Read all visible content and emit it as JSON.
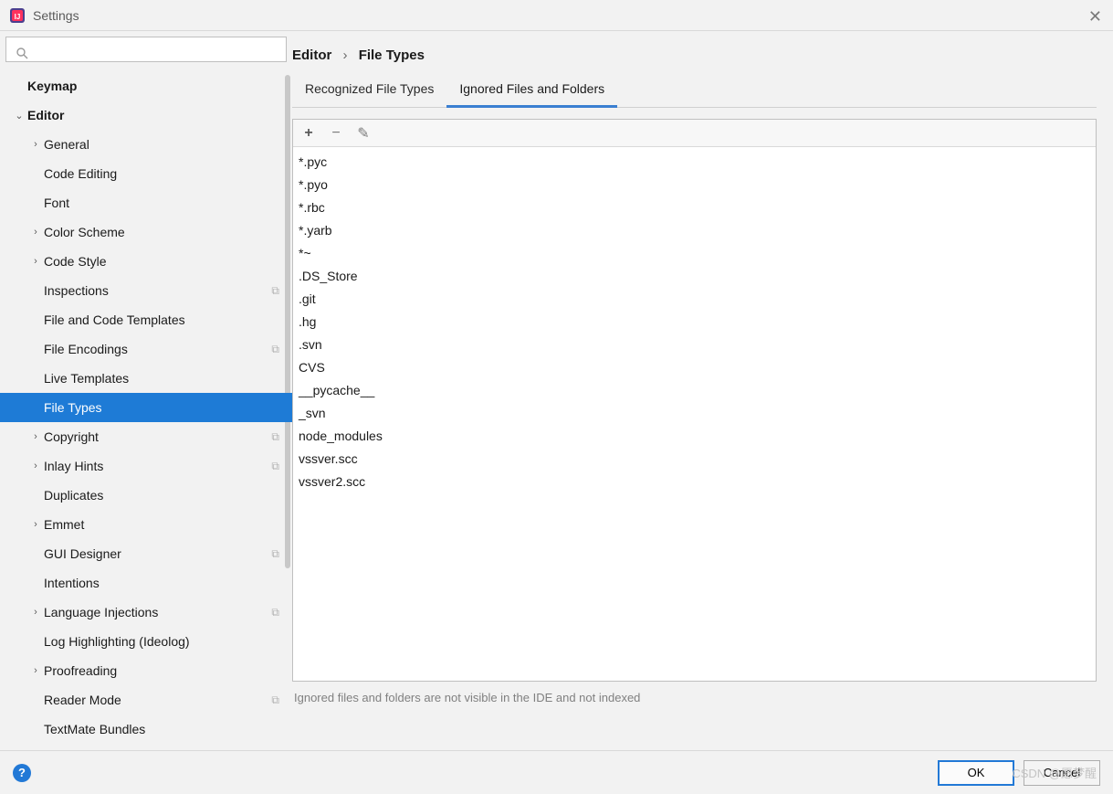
{
  "window": {
    "title": "Settings"
  },
  "breadcrumb": {
    "parent": "Editor",
    "current": "File Types"
  },
  "search": {
    "placeholder": ""
  },
  "tree": [
    {
      "label": "Keymap",
      "depth": 0,
      "expandable": false,
      "bold": true,
      "selected": false,
      "copy": false
    },
    {
      "label": "Editor",
      "depth": 0,
      "expandable": true,
      "expanded": true,
      "bold": true,
      "selected": false,
      "copy": false
    },
    {
      "label": "General",
      "depth": 1,
      "expandable": true,
      "expanded": false,
      "bold": false,
      "selected": false,
      "copy": false
    },
    {
      "label": "Code Editing",
      "depth": 1,
      "expandable": false,
      "bold": false,
      "selected": false,
      "copy": false
    },
    {
      "label": "Font",
      "depth": 1,
      "expandable": false,
      "bold": false,
      "selected": false,
      "copy": false
    },
    {
      "label": "Color Scheme",
      "depth": 1,
      "expandable": true,
      "expanded": false,
      "bold": false,
      "selected": false,
      "copy": false
    },
    {
      "label": "Code Style",
      "depth": 1,
      "expandable": true,
      "expanded": false,
      "bold": false,
      "selected": false,
      "copy": false
    },
    {
      "label": "Inspections",
      "depth": 1,
      "expandable": false,
      "bold": false,
      "selected": false,
      "copy": true
    },
    {
      "label": "File and Code Templates",
      "depth": 1,
      "expandable": false,
      "bold": false,
      "selected": false,
      "copy": false
    },
    {
      "label": "File Encodings",
      "depth": 1,
      "expandable": false,
      "bold": false,
      "selected": false,
      "copy": true
    },
    {
      "label": "Live Templates",
      "depth": 1,
      "expandable": false,
      "bold": false,
      "selected": false,
      "copy": false
    },
    {
      "label": "File Types",
      "depth": 1,
      "expandable": false,
      "bold": false,
      "selected": true,
      "copy": false
    },
    {
      "label": "Copyright",
      "depth": 1,
      "expandable": true,
      "expanded": false,
      "bold": false,
      "selected": false,
      "copy": true
    },
    {
      "label": "Inlay Hints",
      "depth": 1,
      "expandable": true,
      "expanded": false,
      "bold": false,
      "selected": false,
      "copy": true
    },
    {
      "label": "Duplicates",
      "depth": 1,
      "expandable": false,
      "bold": false,
      "selected": false,
      "copy": false
    },
    {
      "label": "Emmet",
      "depth": 1,
      "expandable": true,
      "expanded": false,
      "bold": false,
      "selected": false,
      "copy": false
    },
    {
      "label": "GUI Designer",
      "depth": 1,
      "expandable": false,
      "bold": false,
      "selected": false,
      "copy": true
    },
    {
      "label": "Intentions",
      "depth": 1,
      "expandable": false,
      "bold": false,
      "selected": false,
      "copy": false
    },
    {
      "label": "Language Injections",
      "depth": 1,
      "expandable": true,
      "expanded": false,
      "bold": false,
      "selected": false,
      "copy": true
    },
    {
      "label": "Log Highlighting (Ideolog)",
      "depth": 1,
      "expandable": false,
      "bold": false,
      "selected": false,
      "copy": false
    },
    {
      "label": "Proofreading",
      "depth": 1,
      "expandable": true,
      "expanded": false,
      "bold": false,
      "selected": false,
      "copy": false
    },
    {
      "label": "Reader Mode",
      "depth": 1,
      "expandable": false,
      "bold": false,
      "selected": false,
      "copy": true
    },
    {
      "label": "TextMate Bundles",
      "depth": 1,
      "expandable": false,
      "bold": false,
      "selected": false,
      "copy": false
    }
  ],
  "tabs": [
    {
      "label": "Recognized File Types",
      "active": false
    },
    {
      "label": "Ignored Files and Folders",
      "active": true
    }
  ],
  "toolbar": {
    "add": "+",
    "remove": "−",
    "edit": "✎"
  },
  "patterns": [
    "*.pyc",
    "*.pyo",
    "*.rbc",
    "*.yarb",
    "*~",
    ".DS_Store",
    ".git",
    ".hg",
    ".svn",
    "CVS",
    "__pycache__",
    "_svn",
    "node_modules",
    "vssver.scc",
    "vssver2.scc"
  ],
  "hint": "Ignored files and folders are not visible in the IDE and not indexed",
  "footer": {
    "ok": "OK",
    "cancel": "Cancel"
  },
  "watermark": "CSDN @愿梦醒"
}
